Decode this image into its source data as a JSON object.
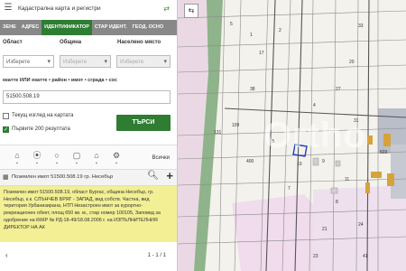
{
  "header": {
    "title": "Кадастрална карта и регистри"
  },
  "tabs": [
    {
      "label": "ЗЕНЕ"
    },
    {
      "label": "АДРЕС"
    },
    {
      "label": "ИДЕНТИФИКАТОР"
    },
    {
      "label": "СТАР ИДЕНТ."
    },
    {
      "label": "ГЕОД. ОСНО"
    }
  ],
  "form": {
    "oblast_label": "Област",
    "obshtina_label": "Община",
    "naseleno_label": "Населено място",
    "oblast_value": "Изберете",
    "obshtina_value": "Изберете",
    "naseleno_value": "Изберете",
    "hint": "екатте ИЛИ екатте • район • имот • сграда • сос",
    "identifier_value": "51500.508.19",
    "current_view_label": "Текущ изглед на картата",
    "first200_label": "Първите 200 резултата",
    "search_label": "ТЪРСИ",
    "all_label": "Всички"
  },
  "result": {
    "header": "Поземлен имот 51500.508.19 гр. Несебър",
    "description": "Поземлен имот 51500.508.19, област Бургас, община Несебър, гр. Несебър, к.к. СЛЪНЧЕВ БРЯГ - ЗАПАД, вид собств. Частна, вид територия Урбанизирана, НТП Незастроен имот за курортно-рекреационен обект, площ 650 кв. м., стар номер 100105, Заповед за одобрение на КККР № РД-18-49/18.08.2006 г. на ИЗПЪЛНИТЕЛНИЯ ДИРЕКТОР НА АК",
    "pager": "1 - 1 / 1"
  },
  "map": {
    "labels": [
      "5",
      "1",
      "2",
      "3",
      "4",
      "7",
      "8",
      "9",
      "10",
      "11",
      "17",
      "20",
      "21",
      "23",
      "24",
      "27",
      "31",
      "33",
      "38",
      "41",
      "109",
      "131",
      "400",
      "503"
    ],
    "watermark": "Ortho"
  },
  "colors": {
    "accent": "#2e7d32",
    "result_bg": "#f2ef95",
    "tab_bar": "#888888",
    "highlight": "#1f3fbf"
  },
  "icons": [
    "menu-icon",
    "chevron-icon",
    "home-icon",
    "pin-icon",
    "circle-icon",
    "frame-icon",
    "house-icon",
    "settings-icon",
    "list-icon",
    "info-icon",
    "search-icon",
    "plus-icon",
    "prev-icon"
  ]
}
